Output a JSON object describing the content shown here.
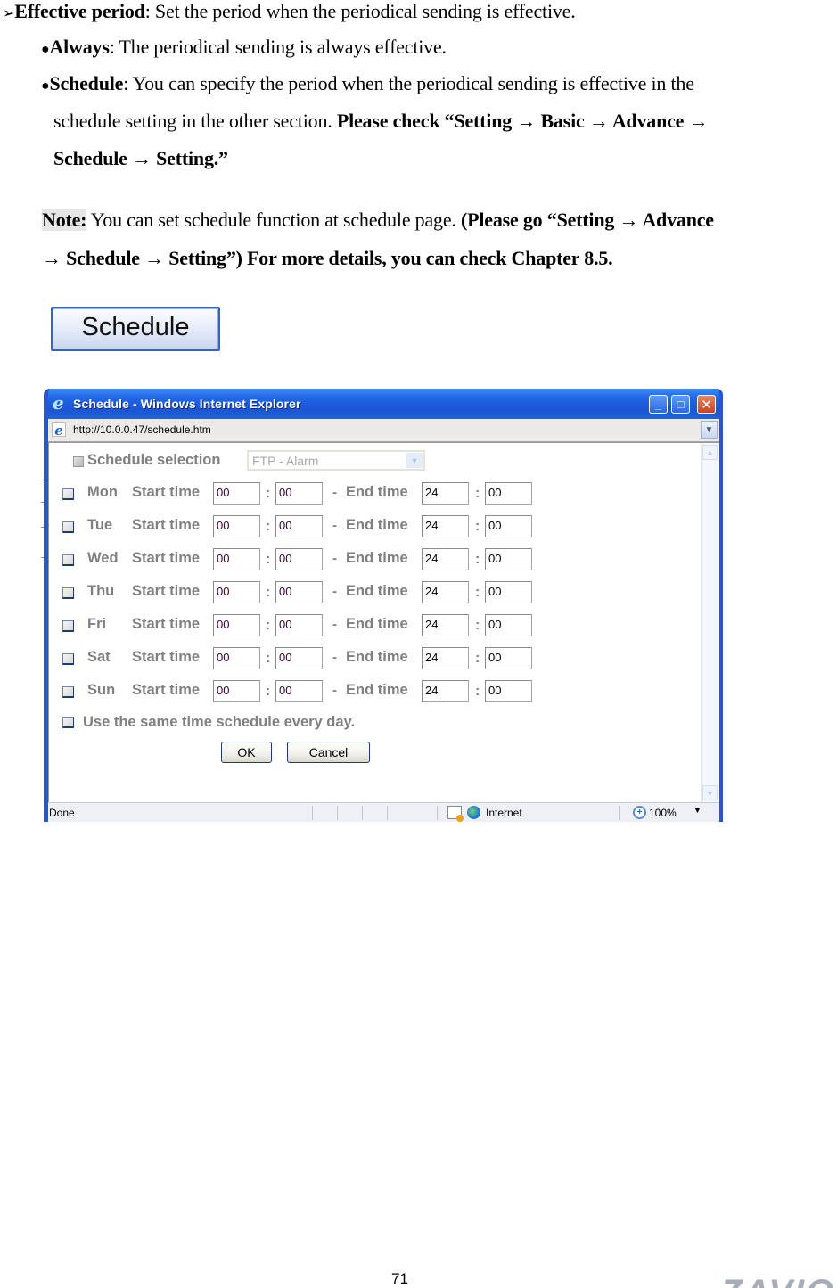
{
  "document": {
    "heading_bullet": "➢",
    "heading_term": "Effective period",
    "heading_text": ": Set the period when the periodical sending is effective.",
    "items": [
      {
        "bullet": "●",
        "term": "Always",
        "text": ": The periodical sending is always effective."
      },
      {
        "bullet": "●",
        "term": "Schedule",
        "text_line1": ": You can specify the period when the periodical sending is effective in the",
        "text_line2": "schedule setting in the other section. ",
        "bold_line2": "Please check “Setting → Basic → Advance →",
        "bold_line3": "Schedule → Setting.”"
      }
    ],
    "note": {
      "label": "Note:",
      "text": " You can set schedule function at schedule page. ",
      "bold_line1": "(Please go “Setting → Advance",
      "bold_line2": "→ Schedule → Setting”) For more details, you can check Chapter 8.5."
    },
    "schedule_button_label": "Schedule",
    "page_number": "71",
    "brand_text": "ZAVIO"
  },
  "ie_window": {
    "title": "Schedule - Windows Internet Explorer",
    "controls": {
      "minimize": "_",
      "maximize": "□",
      "close": "✕"
    },
    "address": "http://10.0.0.47/schedule.htm",
    "schedule_selection_label": "Schedule selection",
    "schedule_selection_value": "FTP - Alarm",
    "start_label": "Start time",
    "end_label": "End time",
    "colon": ":",
    "dash": "-",
    "days": [
      {
        "day": "Mon",
        "checked": false,
        "start_h": "00",
        "start_m": "00",
        "end_h": "24",
        "end_m": "00"
      },
      {
        "day": "Tue",
        "checked": false,
        "start_h": "00",
        "start_m": "00",
        "end_h": "24",
        "end_m": "00"
      },
      {
        "day": "Wed",
        "checked": false,
        "start_h": "00",
        "start_m": "00",
        "end_h": "24",
        "end_m": "00"
      },
      {
        "day": "Thu",
        "checked": false,
        "start_h": "00",
        "start_m": "00",
        "end_h": "24",
        "end_m": "00"
      },
      {
        "day": "Fri",
        "checked": false,
        "start_h": "00",
        "start_m": "00",
        "end_h": "24",
        "end_m": "00"
      },
      {
        "day": "Sat",
        "checked": false,
        "start_h": "00",
        "start_m": "00",
        "end_h": "24",
        "end_m": "00"
      },
      {
        "day": "Sun",
        "checked": false,
        "start_h": "00",
        "start_m": "00",
        "end_h": "24",
        "end_m": "00"
      }
    ],
    "same_schedule_label": "Use the same time schedule every day.",
    "ok_label": "OK",
    "cancel_label": "Cancel",
    "status": {
      "text": "Done",
      "zone": "Internet",
      "zoom": "100%"
    }
  }
}
